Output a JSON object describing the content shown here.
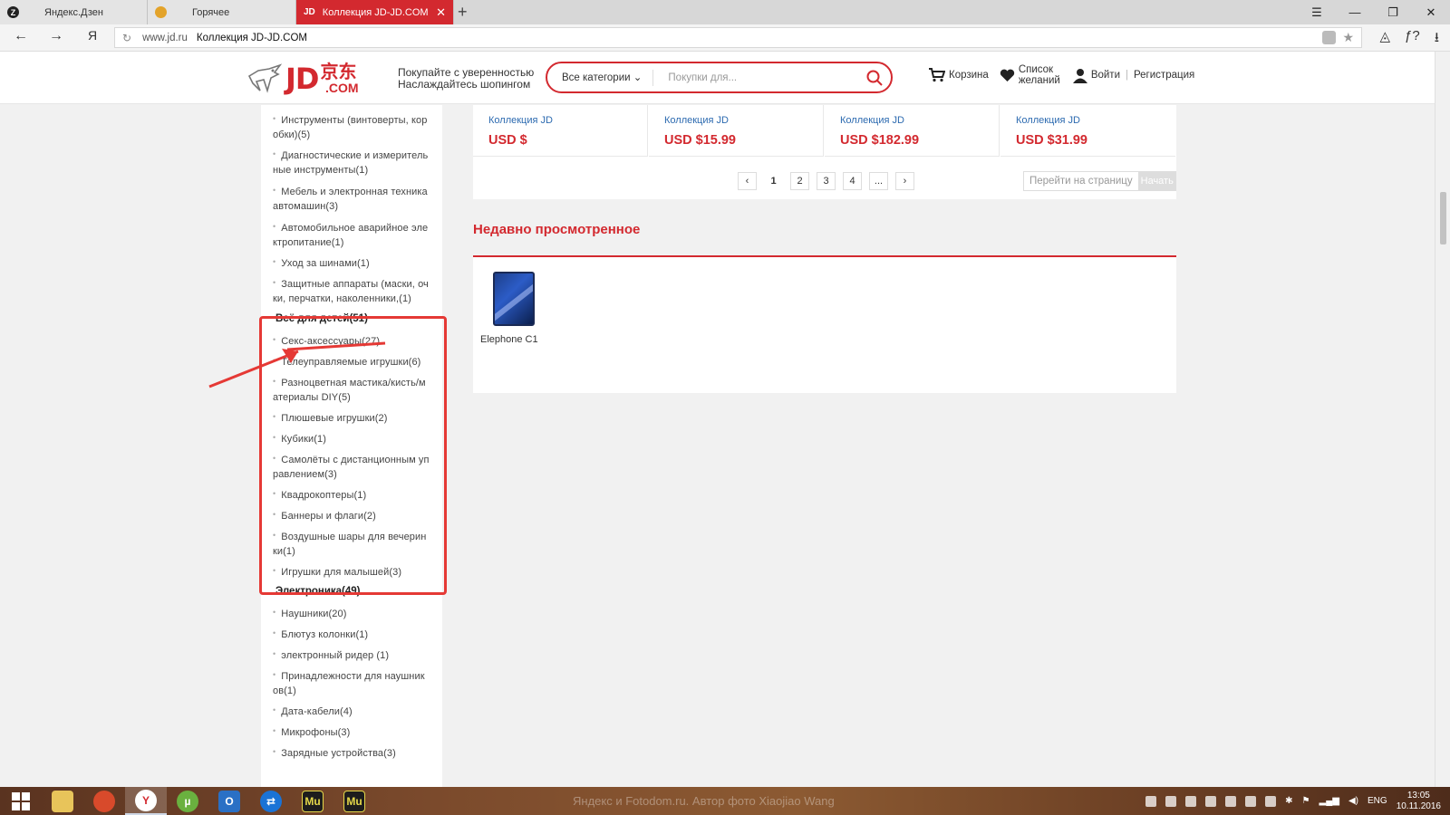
{
  "browser": {
    "tabs": [
      {
        "label": "Яндекс.Дзен",
        "icon": "zen-icon",
        "favicon_char": "Z"
      },
      {
        "label": "Горячее",
        "icon": "pikabu-icon",
        "favicon_char": ""
      },
      {
        "label": "Коллекция JD-JD.COM",
        "icon": "jd-icon",
        "favicon_char": "JD",
        "active": true
      }
    ],
    "new_tab": "+",
    "address": {
      "domain": "www.jd.ru",
      "title": "Коллекция JD-JD.COM"
    },
    "yandex_btn": "Я",
    "tools": [
      "ƒ?"
    ]
  },
  "site": {
    "logo": {
      "jd": "JD",
      "cn": "京东",
      "com": ".COM"
    },
    "slogan": [
      "Покупайте с уверенностью",
      "Наслаждайтесь шопингом"
    ],
    "search": {
      "category": "Все категории",
      "placeholder": "Покупки для..."
    },
    "links": {
      "cart": "Корзина",
      "wishlist": "Список желаний",
      "login": "Войти",
      "register": "Регистрация"
    },
    "accent_color": "#d3292f"
  },
  "sidebar": {
    "items": [
      {
        "label": "Инструменты (винтоверты, коробки)(5)",
        "text": "Инструменты (винтоверты, кор обки)(5)"
      },
      {
        "text": "Диагностические и измерительные инструменты(1)"
      },
      {
        "text": "Мебель и электронная техника автомашин(3)"
      },
      {
        "text": "Автомобильное аварийное электропитание(1)"
      },
      {
        "text": "Уход за шинами(1)"
      },
      {
        "text": "Защитные аппараты (маски, очки, перчатки, наколенники,(1)"
      }
    ],
    "kids_category": "Всё для детей(51)",
    "kids_items": [
      "Секс-аксессуары(27)",
      "Телеуправляемые игрушки(6)",
      "Разноцветная мастика/кисть/материалы DIY(5)",
      "Плюшевые игрушки(2)",
      "Кубики(1)",
      "Самолёты с дистанционным управлением(3)",
      "Квадрокоптеры(1)",
      "Баннеры и флаги(2)",
      "Воздушные шары для вечеринки(1)",
      "Игрушки для малышей(3)"
    ],
    "electronics_category": "Электроника(49)",
    "electronics_items": [
      "Наушники(20)",
      "Блютуз колонки(1)",
      "электронный ридер (1)",
      "Принадлежности для наушников(1)",
      "Дата-кабели(4)",
      "Микрофоны(3)",
      "Зарядные устройства(3)"
    ]
  },
  "products": [
    {
      "brand": "Коллекция JD",
      "price": "USD $"
    },
    {
      "brand": "Коллекция JD",
      "price": "USD $15.99"
    },
    {
      "brand": "Коллекция JD",
      "price": "USD $182.99"
    },
    {
      "brand": "Коллекция JD",
      "price": "USD $31.99"
    }
  ],
  "pagination": {
    "prev": "‹",
    "pages": [
      "1",
      "2",
      "3",
      "4"
    ],
    "ellipsis": "...",
    "next": "›",
    "current": "1",
    "goto_label": "Перейти на страницу",
    "goto_button": "Начать"
  },
  "recent": {
    "title": "Недавно просмотренное",
    "items": [
      {
        "name": "Elephone C1"
      }
    ]
  },
  "taskbar": {
    "watermark": "Яндекс и Fotodom.ru. Автор фото Xiaojiao Wang",
    "lang": "ENG",
    "time": "13:05",
    "date": "10.11.2016"
  }
}
